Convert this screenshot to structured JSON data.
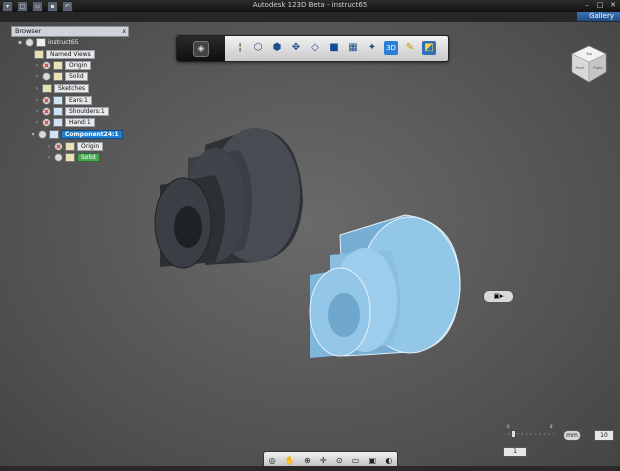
{
  "window": {
    "title": "Autodesk 123D Beta - instruct65",
    "quick_access_icons": [
      "app-menu-icon",
      "new-icon",
      "open-icon",
      "save-icon",
      "undo-icon"
    ],
    "controls": [
      "minimize",
      "maximize",
      "close"
    ]
  },
  "gallery_label": "Gallery",
  "browser": {
    "header": "Browser",
    "close_glyph": "x",
    "root": "instruct65",
    "items": [
      {
        "label": "Named Views",
        "icon": "folder-icon"
      },
      {
        "label": "Origin",
        "icon": "folder-icon",
        "hidden": true
      },
      {
        "label": "Solid",
        "icon": "solid-icon"
      },
      {
        "label": "Sketches",
        "icon": "folder-icon"
      },
      {
        "label": "Ears:1",
        "icon": "component-icon",
        "hidden": true
      },
      {
        "label": "Shoulders:1",
        "icon": "component-icon",
        "hidden": true
      },
      {
        "label": "Hand:1",
        "icon": "component-icon",
        "hidden": true
      },
      {
        "label": "Component24:1",
        "icon": "component-icon",
        "selected": true
      },
      {
        "label": "Origin",
        "icon": "folder-icon",
        "hidden": true
      },
      {
        "label": "Solid",
        "icon": "solid-icon",
        "active": true
      }
    ]
  },
  "toolbar_icons": [
    "info-icon",
    "box-icon",
    "cylinder-icon",
    "pyramid-icon",
    "torus-icon",
    "combine-icon",
    "pattern-icon",
    "sphere-icon",
    "3d-text-icon",
    "sketch-icon",
    "smart-tool-icon"
  ],
  "viewcube_faces": {
    "top": "Top",
    "left": "Front",
    "right": "Right"
  },
  "navbar_icons": [
    "steering-wheel-icon",
    "pan-icon",
    "zoom-icon",
    "orbit-icon",
    "look-icon",
    "fit-icon",
    "view-icon",
    "visual-style-icon"
  ],
  "grid": {
    "unit": "mm",
    "size": "10",
    "snap": "1",
    "scale_ticks": [
      "0",
      "8"
    ]
  },
  "colors": {
    "selected_part": "#8ec4e6",
    "dark_part": "#3d4249",
    "highlight": "#1e7fd3"
  }
}
